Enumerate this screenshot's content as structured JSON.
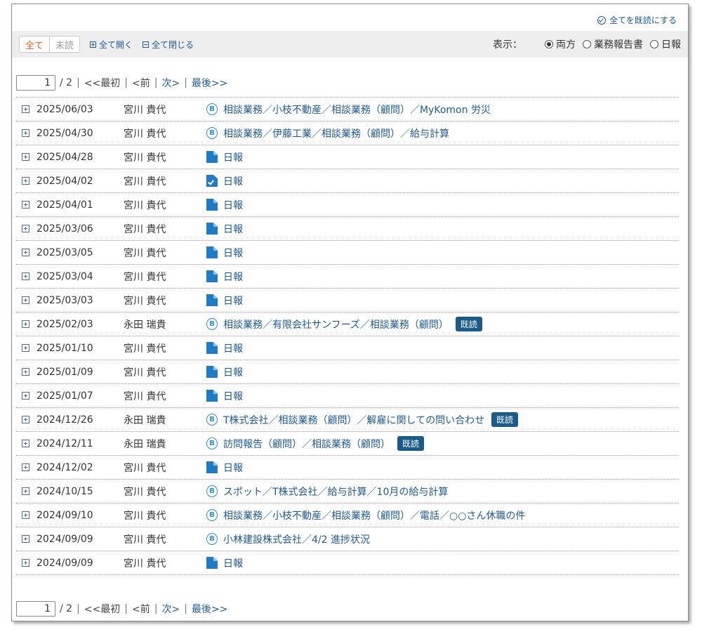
{
  "header": {
    "mark_all_read": "全てを既読にする"
  },
  "toolbar": {
    "filter_all": "全て",
    "filter_unread": "未読",
    "expand_all": "全て開く",
    "collapse_all": "全て閉じる",
    "display_label": "表示：",
    "radio_both": "両方",
    "radio_business_report": "業務報告書",
    "radio_daily": "日報",
    "selected_display": "両方"
  },
  "pager": {
    "current_page": "1",
    "total": "/ 2",
    "first": "<<最初",
    "prev": "<前",
    "next": "次>",
    "last": "最後>>",
    "sep": "|"
  },
  "rows": [
    {
      "date": "2025/06/03",
      "author": "宮川 貴代",
      "icon": "b-circle-icon",
      "title": "相談業務／小枝不動産／相談業務（顧問）／MyKomon 労災",
      "badge": ""
    },
    {
      "date": "2025/04/30",
      "author": "宮川 貴代",
      "icon": "b-circle-icon",
      "title": "相談業務／伊藤工業／相談業務（顧問）／給与計算",
      "badge": ""
    },
    {
      "date": "2025/04/28",
      "author": "宮川 貴代",
      "icon": "document-icon",
      "title": "日報",
      "badge": ""
    },
    {
      "date": "2025/04/02",
      "author": "宮川 貴代",
      "icon": "document-check-icon",
      "title": "日報",
      "badge": ""
    },
    {
      "date": "2025/04/01",
      "author": "宮川 貴代",
      "icon": "document-icon",
      "title": "日報",
      "badge": ""
    },
    {
      "date": "2025/03/06",
      "author": "宮川 貴代",
      "icon": "document-icon",
      "title": "日報",
      "badge": ""
    },
    {
      "date": "2025/03/05",
      "author": "宮川 貴代",
      "icon": "document-icon",
      "title": "日報",
      "badge": ""
    },
    {
      "date": "2025/03/04",
      "author": "宮川 貴代",
      "icon": "document-icon",
      "title": "日報",
      "badge": ""
    },
    {
      "date": "2025/03/03",
      "author": "宮川 貴代",
      "icon": "document-icon",
      "title": "日報",
      "badge": ""
    },
    {
      "date": "2025/02/03",
      "author": "永田 瑞貴",
      "icon": "b-circle-icon",
      "title": "相談業務／有限会社サンフーズ／相談業務（顧問）",
      "badge": "既読"
    },
    {
      "date": "2025/01/10",
      "author": "宮川 貴代",
      "icon": "document-icon",
      "title": "日報",
      "badge": ""
    },
    {
      "date": "2025/01/09",
      "author": "宮川 貴代",
      "icon": "document-icon",
      "title": "日報",
      "badge": ""
    },
    {
      "date": "2025/01/07",
      "author": "宮川 貴代",
      "icon": "document-icon",
      "title": "日報",
      "badge": ""
    },
    {
      "date": "2024/12/26",
      "author": "永田 瑞貴",
      "icon": "b-circle-icon",
      "title": "T株式会社／相談業務（顧問）／解雇に関しての問い合わせ",
      "badge": "既読"
    },
    {
      "date": "2024/12/11",
      "author": "永田 瑞貴",
      "icon": "b-circle-icon",
      "title": "訪問報告（顧問）／相談業務（顧問）",
      "badge": "既読"
    },
    {
      "date": "2024/12/02",
      "author": "宮川 貴代",
      "icon": "document-icon",
      "title": "日報",
      "badge": ""
    },
    {
      "date": "2024/10/15",
      "author": "宮川 貴代",
      "icon": "b-circle-icon",
      "title": "スポット／T株式会社／給与計算／10月の給与計算",
      "badge": ""
    },
    {
      "date": "2024/09/10",
      "author": "宮川 貴代",
      "icon": "b-circle-icon",
      "title": "相談業務／小枝不動産／相談業務（顧問）／電話／○○さん休職の件",
      "badge": ""
    },
    {
      "date": "2024/09/09",
      "author": "宮川 貴代",
      "icon": "b-circle-icon",
      "title": "小林建設株式会社／4/2 進捗状況",
      "badge": ""
    },
    {
      "date": "2024/09/09",
      "author": "宮川 貴代",
      "icon": "document-icon",
      "title": "日報",
      "badge": ""
    }
  ],
  "colors": {
    "link": "#1e5a98",
    "accent_active": "#e35d2c",
    "icon_blue": "#1e7bc4",
    "badge_bg": "#1a5b8a",
    "toolbar_bg": "#eeeeee"
  }
}
